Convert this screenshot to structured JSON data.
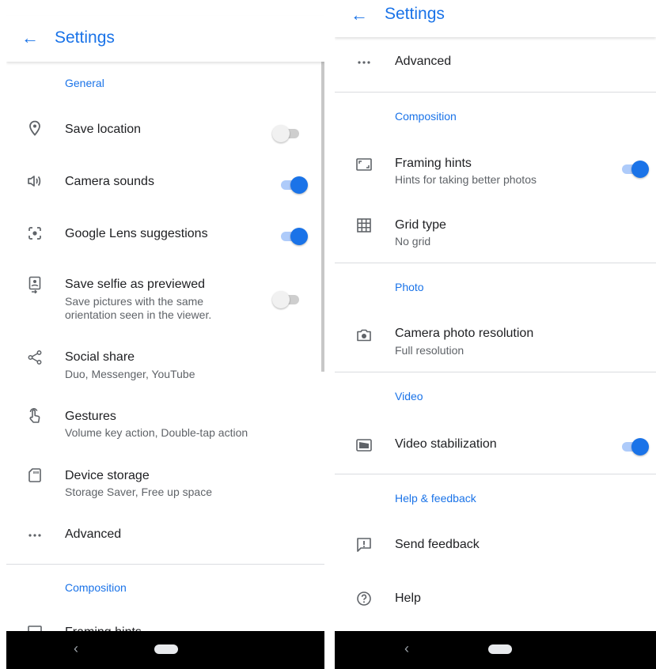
{
  "left": {
    "title": "Settings",
    "sections": {
      "general": "General",
      "composition": "Composition"
    },
    "items": {
      "save_location": {
        "label": "Save location",
        "toggle": false
      },
      "camera_sounds": {
        "label": "Camera sounds",
        "toggle": true
      },
      "google_lens": {
        "label": "Google Lens suggestions",
        "toggle": true
      },
      "save_selfie": {
        "label": "Save selfie as previewed",
        "sub1": "Save pictures with the same",
        "sub2": "orientation seen in the viewer.",
        "toggle": false
      },
      "social_share": {
        "label": "Social share",
        "sub": "Duo, Messenger, YouTube"
      },
      "gestures": {
        "label": "Gestures",
        "sub": "Volume key action, Double-tap action"
      },
      "device_storage": {
        "label": "Device storage",
        "sub": "Storage Saver, Free up space"
      },
      "advanced": {
        "label": "Advanced"
      },
      "framing_hints": {
        "label": "Framing hints"
      }
    }
  },
  "right": {
    "title": "Settings",
    "sections": {
      "composition": "Composition",
      "photo": "Photo",
      "video": "Video",
      "help_feedback": "Help & feedback"
    },
    "items": {
      "advanced": {
        "label": "Advanced"
      },
      "framing_hints": {
        "label": "Framing hints",
        "sub": "Hints for taking better photos",
        "toggle": true
      },
      "grid_type": {
        "label": "Grid type",
        "sub": "No grid"
      },
      "photo_resolution": {
        "label": "Camera photo resolution",
        "sub": "Full resolution"
      },
      "video_stabilization": {
        "label": "Video stabilization",
        "toggle": true
      },
      "send_feedback": {
        "label": "Send feedback"
      },
      "help": {
        "label": "Help"
      }
    }
  },
  "icons": {
    "back": "arrow-back-icon",
    "location": "location-pin-icon",
    "sound": "speaker-icon",
    "lens": "lens-icon",
    "selfie": "selfie-icon",
    "share": "share-icon",
    "gesture": "touch-gesture-icon",
    "storage": "sd-card-icon",
    "more": "more-horiz-icon",
    "framing": "framing-icon",
    "grid": "grid-icon",
    "camera": "camera-icon",
    "video": "video-stabilization-icon",
    "feedback": "feedback-icon",
    "help": "help-icon",
    "nav_back": "nav-back-icon",
    "home": "home-pill-icon"
  },
  "colors": {
    "accent": "#1a73e8",
    "toggle_on_track": "#aecbfa",
    "text_primary": "#202124",
    "text_secondary": "#5f6368",
    "divider": "#dadce0",
    "navbar": "#000000"
  }
}
